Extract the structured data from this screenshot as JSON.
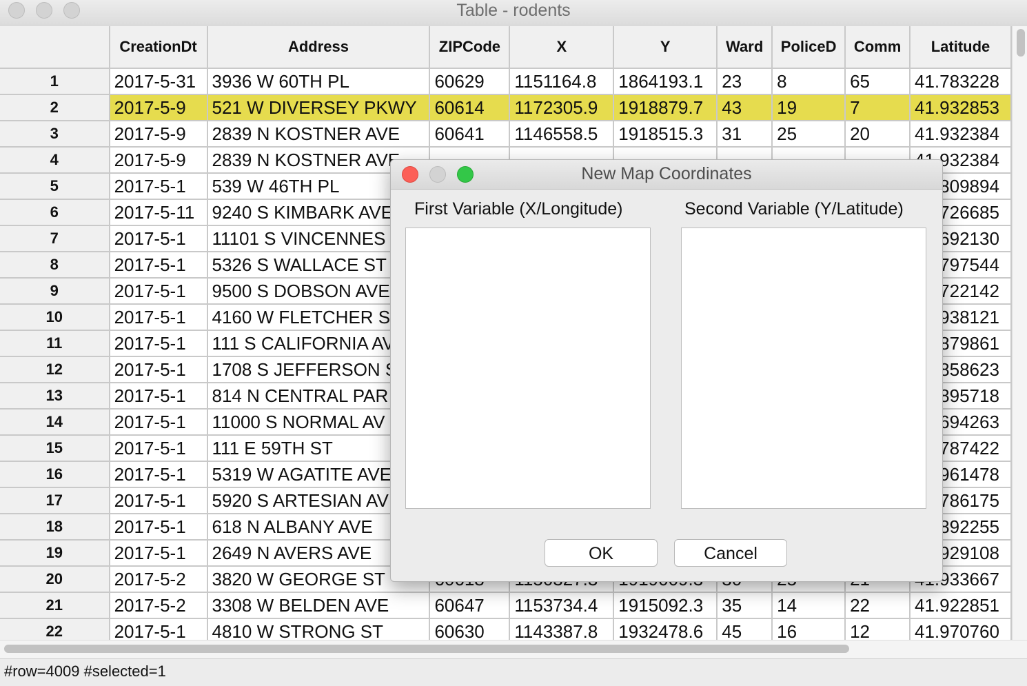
{
  "window": {
    "title": "Table - rodents"
  },
  "table": {
    "columns": [
      "",
      "CreationDt",
      "Address",
      "ZIPCode",
      "X",
      "Y",
      "Ward",
      "PoliceD",
      "Comm",
      "Latitude"
    ],
    "rows": [
      [
        "1",
        "2017-5-31",
        "3936 W 60TH PL",
        "60629",
        "1151164.8",
        "1864193.1",
        "23",
        "8",
        "65",
        "41.783228"
      ],
      [
        "2",
        "2017-5-9",
        "521 W DIVERSEY PKWY",
        "60614",
        "1172305.9",
        "1918879.7",
        "43",
        "19",
        "7",
        "41.932853"
      ],
      [
        "3",
        "2017-5-9",
        "2839 N KOSTNER AVE",
        "60641",
        "1146558.5",
        "1918515.3",
        "31",
        "25",
        "20",
        "41.932384"
      ],
      [
        "4",
        "2017-5-9",
        "2839 N KOSTNER AVE",
        "",
        "",
        "",
        "",
        "",
        "",
        "41.932384"
      ],
      [
        "5",
        "2017-5-1",
        "539 W 46TH PL",
        "",
        "",
        "",
        "",
        "",
        "",
        "41.809894"
      ],
      [
        "6",
        "2017-5-11",
        "9240 S KIMBARK AVE",
        "",
        "",
        "",
        "",
        "",
        "",
        "41.726685"
      ],
      [
        "7",
        "2017-5-1",
        "11101 S VINCENNES",
        "",
        "",
        "",
        "",
        "",
        "",
        "41.692130"
      ],
      [
        "8",
        "2017-5-1",
        "5326 S WALLACE ST",
        "",
        "",
        "",
        "",
        "",
        "",
        "41.797544"
      ],
      [
        "9",
        "2017-5-1",
        "9500 S DOBSON AVE",
        "",
        "",
        "",
        "",
        "",
        "",
        "41.722142"
      ],
      [
        "10",
        "2017-5-1",
        "4160 W FLETCHER S",
        "",
        "",
        "",
        "",
        "",
        "",
        "41.938121"
      ],
      [
        "11",
        "2017-5-1",
        "111 S CALIFORNIA AV",
        "",
        "",
        "",
        "",
        "",
        "",
        "41.879861"
      ],
      [
        "12",
        "2017-5-1",
        "1708 S JEFFERSON S",
        "",
        "",
        "",
        "",
        "",
        "",
        "41.858623"
      ],
      [
        "13",
        "2017-5-1",
        "814 N CENTRAL PAR",
        "",
        "",
        "",
        "",
        "",
        "",
        "41.895718"
      ],
      [
        "14",
        "2017-5-1",
        "11000 S NORMAL AV",
        "",
        "",
        "",
        "",
        "",
        "",
        "41.694263"
      ],
      [
        "15",
        "2017-5-1",
        "111 E 59TH ST",
        "",
        "",
        "",
        "",
        "",
        "",
        "41.787422"
      ],
      [
        "16",
        "2017-5-1",
        "5319 W AGATITE AVE",
        "",
        "",
        "",
        "",
        "",
        "",
        "41.961478"
      ],
      [
        "17",
        "2017-5-1",
        "5920 S ARTESIAN AV",
        "",
        "",
        "",
        "",
        "",
        "",
        "41.786175"
      ],
      [
        "18",
        "2017-5-1",
        "618 N ALBANY AVE",
        "",
        "",
        "",
        "",
        "",
        "",
        "41.892255"
      ],
      [
        "19",
        "2017-5-1",
        "2649 N AVERS AVE",
        "",
        "",
        "",
        "",
        "",
        "",
        "41.929108"
      ],
      [
        "20",
        "2017-5-2",
        "3820 W GEORGE ST",
        "60618",
        "1150327.3",
        "1919009.3",
        "30",
        "25",
        "21",
        "41.933667"
      ],
      [
        "21",
        "2017-5-2",
        "3308 W BELDEN AVE",
        "60647",
        "1153734.4",
        "1915092.3",
        "35",
        "14",
        "22",
        "41.922851"
      ],
      [
        "22",
        "2017-5-1",
        "4810 W STRONG ST",
        "60630",
        "1143387.8",
        "1932478.6",
        "45",
        "16",
        "12",
        "41.970760"
      ]
    ],
    "selected_row": 2
  },
  "status": {
    "text": "#row=4009 #selected=1"
  },
  "dialog": {
    "title": "New Map Coordinates",
    "first_label": "First Variable (X/Longitude)",
    "second_label": "Second Variable (Y/Latitude)",
    "ok_label": "OK",
    "cancel_label": "Cancel"
  }
}
